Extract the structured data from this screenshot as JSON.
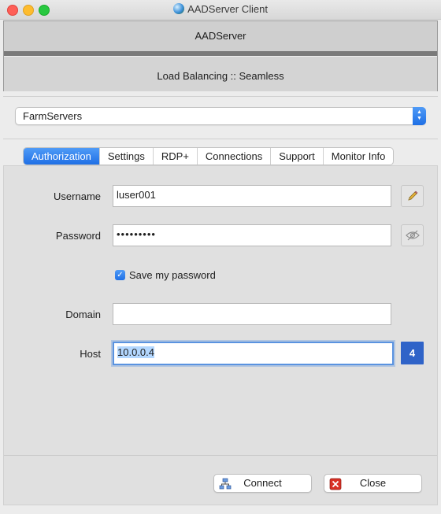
{
  "window": {
    "title": "AADServer Client"
  },
  "banner": {
    "title": "AADServer",
    "mode": "Load Balancing :: Seamless"
  },
  "farm_select": {
    "value": "FarmServers"
  },
  "tabs": [
    {
      "label": "Authorization",
      "active": true
    },
    {
      "label": "Settings",
      "active": false
    },
    {
      "label": "RDP+",
      "active": false
    },
    {
      "label": "Connections",
      "active": false
    },
    {
      "label": "Support",
      "active": false
    },
    {
      "label": "Monitor Info",
      "active": false
    }
  ],
  "form": {
    "username": {
      "label": "Username",
      "value": "luser001"
    },
    "password": {
      "label": "Password",
      "value": "•••••••••"
    },
    "save_password": {
      "label": "Save my password",
      "checked": true
    },
    "domain": {
      "label": "Domain",
      "value": ""
    },
    "host": {
      "label": "Host",
      "value": "10.0.0.4",
      "badge": "4"
    }
  },
  "buttons": {
    "connect": "Connect",
    "close": "Close"
  },
  "colors": {
    "accent": "#1f6fe5",
    "badge": "#2f63c8",
    "close_icon": "#d93025"
  },
  "icons": [
    "app-globe-icon",
    "pencil-icon",
    "eye-slash-icon",
    "network-icon",
    "close-x-icon"
  ]
}
